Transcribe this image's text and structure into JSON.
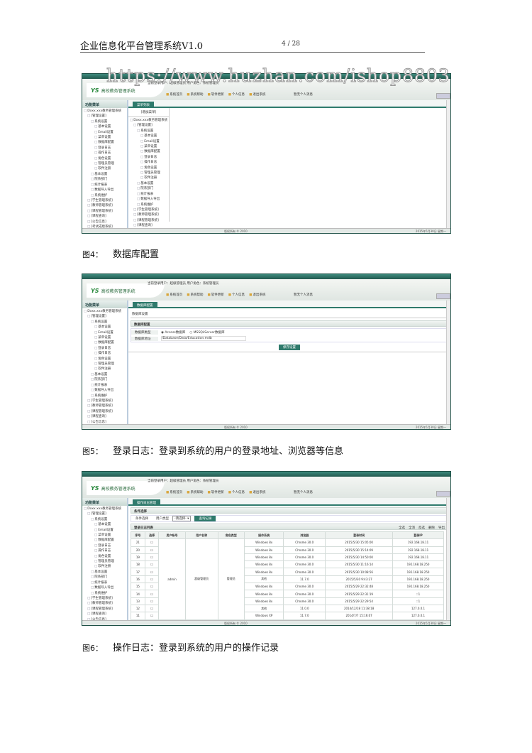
{
  "header": {
    "title": "企业信息化平台管理系统V1.0",
    "page": "4 / 28"
  },
  "watermark": "https://www.huzhan.com/ishop8803",
  "app": {
    "logo_mark": "YS",
    "logo_text": "高校教务管理系统",
    "user_info": "当前登录用户：超级管理员 用户角色：系统管理员",
    "nav": [
      "系统首页",
      "系统帮助",
      "软件更新",
      "个人信息",
      "退出系统"
    ],
    "message": "暂无个人消息",
    "sidebar_title": "功能菜单",
    "tree": [
      {
        "t": "Dxxx.xxx教务管理系统",
        "l": 0
      },
      {
        "t": "[管理设置]",
        "l": 1
      },
      {
        "t": "系统设置",
        "l": 2
      },
      {
        "t": "基本设置",
        "l": 3
      },
      {
        "t": "Email设置",
        "l": 3
      },
      {
        "t": "菜单设置",
        "l": 3
      },
      {
        "t": "数据库配置",
        "l": 3
      },
      {
        "t": "登录日志",
        "l": 3
      },
      {
        "t": "操作日志",
        "l": 3
      },
      {
        "t": "角色设置",
        "l": 3
      },
      {
        "t": "管理员管理",
        "l": 3
      },
      {
        "t": "软件注册",
        "l": 3
      },
      {
        "t": "基本设置",
        "l": 2
      },
      {
        "t": "院系部门",
        "l": 2
      },
      {
        "t": "统计报表",
        "l": 2
      },
      {
        "t": "数据导入导出",
        "l": 2
      },
      {
        "t": "系统维护",
        "l": 2
      },
      {
        "t": "[学生管理系统]",
        "l": 1
      },
      {
        "t": "[教师管理系统]",
        "l": 1
      },
      {
        "t": "[课程管理系统]",
        "l": 1
      },
      {
        "t": "[课程查询]",
        "l": 1
      },
      {
        "t": "[公告信息]",
        "l": 1
      },
      {
        "t": "[考试成绩系统]",
        "l": 1
      }
    ],
    "footer_center": "版权所有 © 2010",
    "footer_right": "2015年5月30日 星期一"
  },
  "shot1": {
    "tab": "菜单列表",
    "add": "[增加菜单]"
  },
  "caption4": {
    "num": "图4：",
    "text": "数据库配置"
  },
  "shot2": {
    "tab": "数据库配置",
    "subtab": "数据库设置",
    "section": "数据库配置",
    "type_label": "数据库类型",
    "opt1": "Access数据库",
    "opt2": "MSSQLServer数据库",
    "addr_label": "数据库地址",
    "addr_value": "/Database/Data/Education.mdb",
    "save": "保存设置"
  },
  "caption5": {
    "num": "图5：",
    "text": "登录日志：登录到系统的用户的登录地址、浏览器等信息"
  },
  "shot3": {
    "tab": "操作日志管理",
    "search_title": "条件选择",
    "cond_label": "条件选择",
    "user_label": "用户类型",
    "select": "-请选择-",
    "search_btn": "查询记录",
    "list_title": "登录日志列表",
    "actions": [
      "全选",
      "全消",
      "反选",
      "删除",
      "导出"
    ],
    "columns": [
      "序号",
      "选择",
      "用户帐号",
      "用户名称",
      "角色类型",
      "操作系统",
      "浏览器",
      "登录时间",
      "登录IP"
    ],
    "account": "admin",
    "name": "超级管理员",
    "role": "管理员",
    "rows": [
      [
        "21",
        "Windows 8x",
        "Chrome 30.0",
        "2015/5/30 15:05:00",
        "192.168.18.11"
      ],
      [
        "20",
        "Windows 8x",
        "Chrome 30.0",
        "2015/5/30 15:14:09",
        "192.168.18.11"
      ],
      [
        "19",
        "Windows 8x",
        "Chrome 30.0",
        "2015/5/30 14:50:00",
        "192.168.18.11"
      ],
      [
        "18",
        "Windows 8x",
        "Chrome 30.0",
        "2015/5/30 11:16:14",
        "192.168.18.250"
      ],
      [
        "17",
        "Windows 8x",
        "Chrome 30.0",
        "2015/5/30 10:08:56",
        "192.168.18.250"
      ],
      [
        "16",
        "其他",
        "11.7.0",
        "2015/5/30 9:43:27",
        "192.168.18.250"
      ],
      [
        "15",
        "Windows 8x",
        "Chrome 30.0",
        "2015/5/29 22:32:48",
        "192.168.18.250"
      ],
      [
        "14",
        "Windows 8x",
        "Chrome 30.0",
        "2015/5/29 22:31:19",
        "::1"
      ],
      [
        "13",
        "Windows 8x",
        "Chrome 30.0",
        "2015/5/29 22:29:54",
        "::1"
      ],
      [
        "12",
        "其他",
        "11.0.0",
        "2014/12/18 11:38:18",
        "127.0.0.1"
      ],
      [
        "11",
        "Windows XP",
        "11.7.0",
        "2014/7/7 15:16:07",
        "127.0.0.1"
      ]
    ]
  },
  "caption6": {
    "num": "图6：",
    "text": "操作日志：登录到系统的用户的操作记录"
  }
}
